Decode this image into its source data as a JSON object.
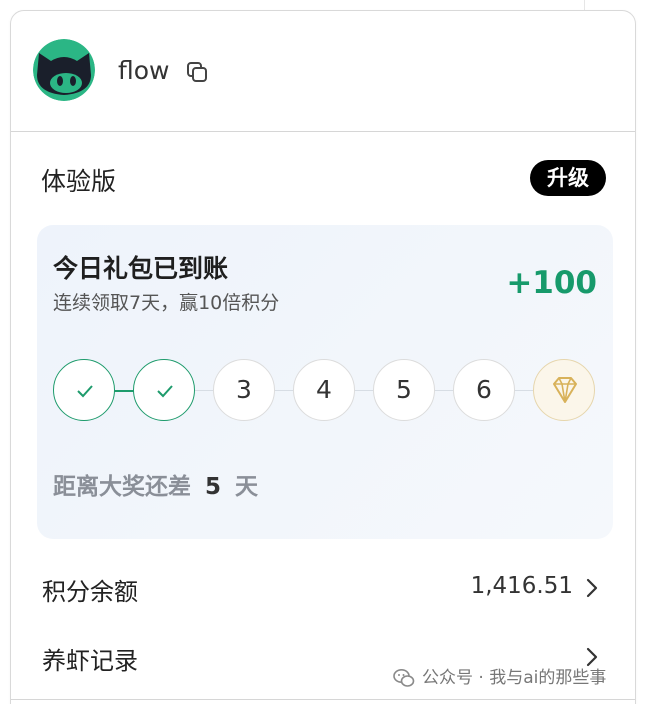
{
  "header": {
    "username": "flow"
  },
  "plan": {
    "label": "体验版",
    "upgrade_label": "升级"
  },
  "gift": {
    "title": "今日礼包已到账",
    "subtitle": "连续领取7天，赢10倍积分",
    "points": "+100",
    "days": [
      {
        "label": "",
        "state": "done"
      },
      {
        "label": "",
        "state": "done"
      },
      {
        "label": "3",
        "state": "pending"
      },
      {
        "label": "4",
        "state": "pending"
      },
      {
        "label": "5",
        "state": "pending"
      },
      {
        "label": "6",
        "state": "pending"
      },
      {
        "label": "",
        "state": "prize"
      }
    ],
    "remaining_prefix": "距离大奖还差",
    "remaining_days": "5",
    "remaining_suffix": "天"
  },
  "balance": {
    "label": "积分余额",
    "value": "1,416.51"
  },
  "shrimp": {
    "label": "养虾记录"
  },
  "watermark": {
    "text": "公众号 · 我与ai的那些事"
  },
  "colors": {
    "accent_green": "#179a6b",
    "upgrade_bg": "#000000",
    "avatar_green": "#2bb685",
    "card_bg": "#f1f5fa"
  }
}
